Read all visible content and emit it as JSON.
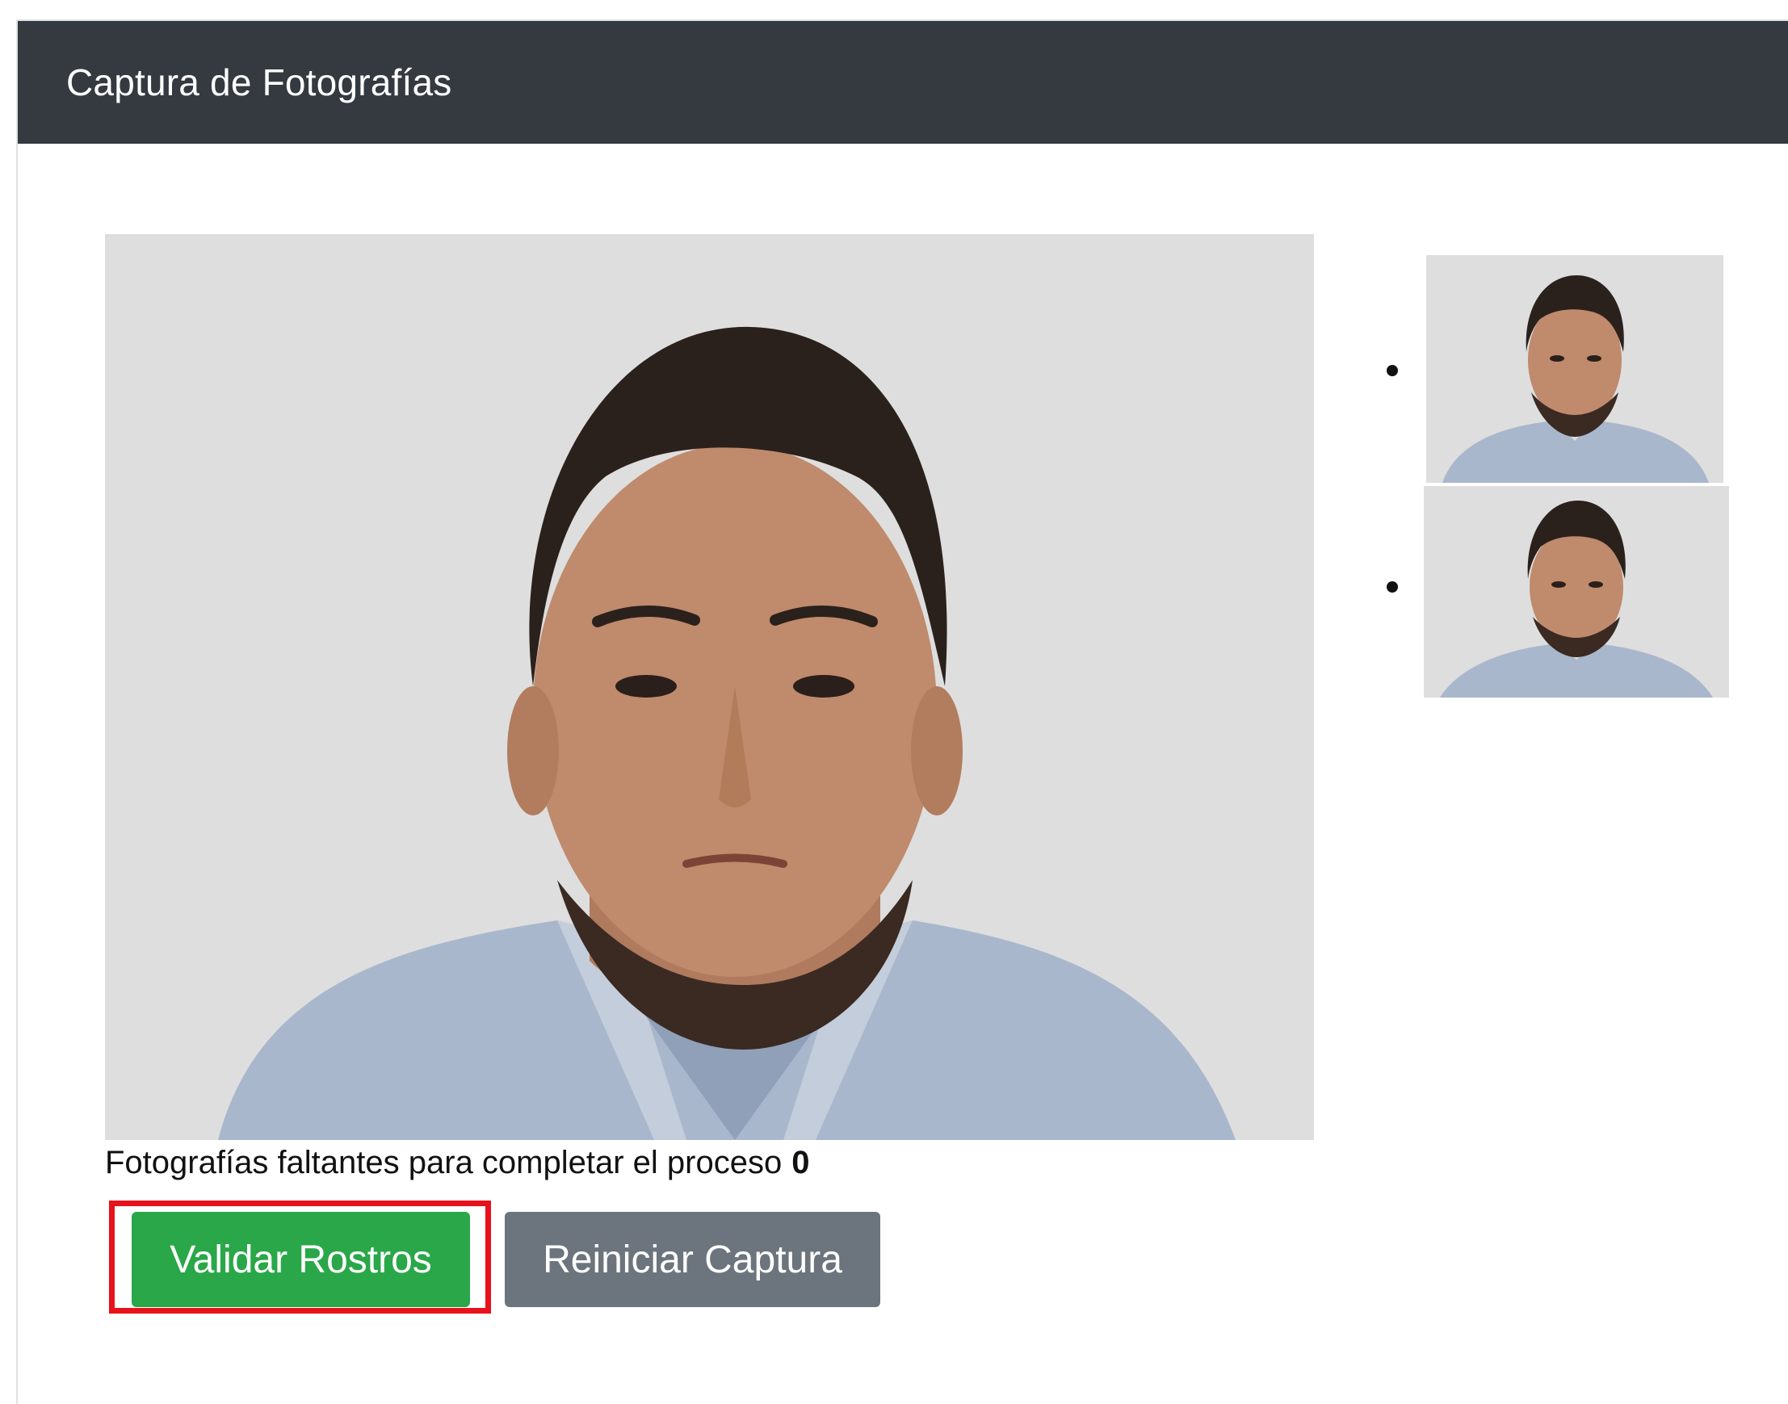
{
  "header": {
    "title": "Captura de Fotografías"
  },
  "main_photo": {
    "alt": "captured face photo"
  },
  "status": {
    "text": "Fotografías faltantes para completar el proceso",
    "remaining": "0"
  },
  "actions": {
    "validate_label": "Validar Rostros",
    "reset_label": "Reiniciar Captura"
  },
  "thumbnails": {
    "count": 2
  },
  "colors": {
    "header_bg": "#343a40",
    "success": "#2aa748",
    "secondary": "#6c757d",
    "highlight": "#e8121c",
    "photo_bg": "#dedede"
  }
}
